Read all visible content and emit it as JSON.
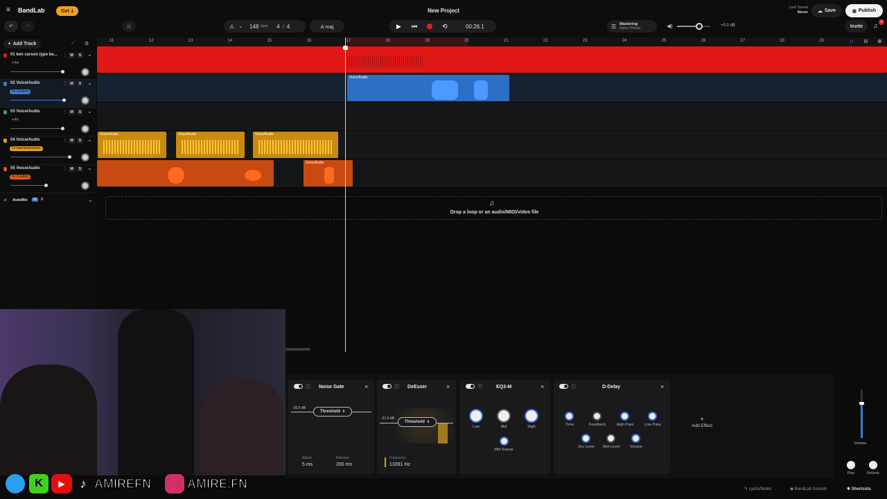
{
  "app": {
    "logo_text": "BandLab",
    "get_label": "Get",
    "project_title": "New Project"
  },
  "transport": {
    "tempo": "148",
    "tempo_unit": "bpm",
    "time_sig_num": "4",
    "time_sig_sep": "/",
    "time_sig_den": "4",
    "key": "A maj",
    "time": "00:26.1"
  },
  "mastering": {
    "title": "Mastering",
    "subtitle": "Select Preset"
  },
  "master_volume": {
    "level_db": "+0.0 dB"
  },
  "save_status": {
    "label": "Last Saved",
    "value": "Never"
  },
  "buttons": {
    "save": "Save",
    "publish": "Publish",
    "invite": "Invite",
    "add_track": "Add Track",
    "add_effect": "Add Effect"
  },
  "notifications": {
    "count": "2"
  },
  "ruler": {
    "bars": [
      "11",
      "12",
      "13",
      "14",
      "15",
      "16",
      "17",
      "18",
      "19",
      "20",
      "21",
      "22",
      "23",
      "24",
      "25",
      "26",
      "27",
      "28",
      "29"
    ]
  },
  "tracks": [
    {
      "name": "01  ken carson type be...",
      "fx": "+ Fx",
      "color": "#e02020",
      "volume": 0.8,
      "mute": "M",
      "solo": "S"
    },
    {
      "name": "02  Voice/Audio",
      "fx": "Fx  Custom",
      "color": "#3d7bd9",
      "volume": 0.82,
      "mute": "M",
      "solo": "S"
    },
    {
      "name": "03  Voice/Audio",
      "fx": "+ Fx",
      "color": "#3aa55a",
      "volume": 0.8,
      "mute": "M",
      "solo": "S"
    },
    {
      "name": "04  Voice/Audio",
      "fx": "Fx  kaanamixsauce",
      "color": "#e0a020",
      "volume": 0.9,
      "mute": "M",
      "solo": "S"
    },
    {
      "name": "05  Voice/Audio",
      "fx": "Fx  Custom",
      "color": "#e05a20",
      "volume": 0.55,
      "mute": "M",
      "solo": "S"
    }
  ],
  "clips": {
    "voice_label": "Voice/Audio"
  },
  "automix": {
    "label": "AutoMix",
    "badge": "AI"
  },
  "drop_zone": {
    "text": "Drop a loop or an audio/MIDI/video file"
  },
  "effects": {
    "noise_gate": {
      "title": "Noise Gate",
      "threshold_db": "-30.0 dB",
      "threshold_label": "Threshold",
      "attack_label": "Attack",
      "attack_value": "5 ms",
      "release_label": "Release",
      "release_value": "200 ms"
    },
    "deesser": {
      "title": "DeEsser",
      "threshold_db": "-21.0 dB",
      "threshold_label": "Threshold",
      "freq_label": "Frequency",
      "freq_value": "13391 Hz"
    },
    "eq3": {
      "title": "EQ3-M",
      "low": "Low",
      "mid": "Mid",
      "high": "High",
      "mid_sweep": "Mid Sweep"
    },
    "ddelay": {
      "title": "D-Delay",
      "time": "Time",
      "feedback": "Feedback",
      "high_pass": "High Pass",
      "low_pass": "Low Pass",
      "dry_level": "Dry Level",
      "wet_level": "Wet Level",
      "volume": "Volume"
    }
  },
  "channel": {
    "volume_label": "Volume",
    "pan_label": "Pan",
    "reverb_label": "Reverb"
  },
  "footer": {
    "lyrics": "Lyrics/Notes",
    "sounds": "BandLab Sounds",
    "shortcuts": "Shortcuts"
  },
  "socials": {
    "handle1": "AMIREFN",
    "handle2": "AMIRE.FN"
  }
}
